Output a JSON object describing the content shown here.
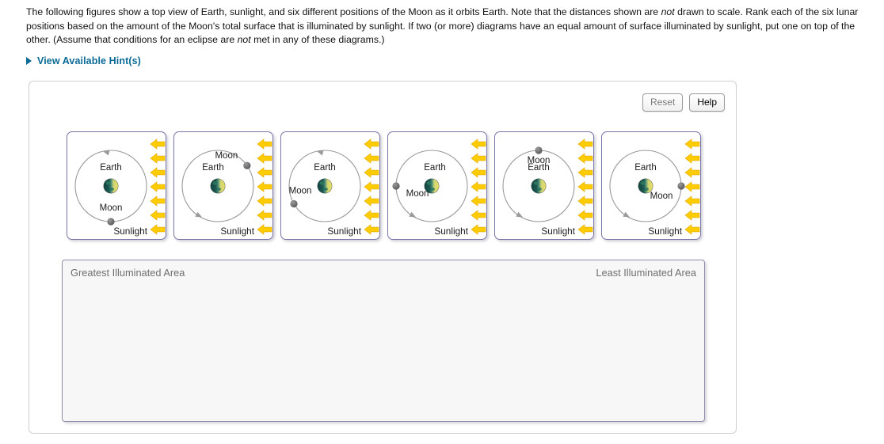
{
  "prompt": {
    "part1": "The following figures show a top view of Earth, sunlight, and six different positions of the Moon as it orbits Earth. Note that the distances shown are ",
    "em1": "not",
    "part2": " drawn to scale. Rank each of the six lunar positions based on the amount of the Moon's total surface that is illuminated by sunlight. If two (or more) diagrams have an equal amount of surface illuminated by sunlight, put one on top of the other. (Assume that conditions for an eclipse are ",
    "em2": "not",
    "part3": " met in any of these diagrams.)"
  },
  "hint": {
    "label": "View Available Hint(s)"
  },
  "toolbar": {
    "reset_label": "Reset",
    "help_label": "Help"
  },
  "ranking": {
    "greatest_label": "Greatest Illuminated Area",
    "least_label": "Least Illuminated Area",
    "items": []
  },
  "labels": {
    "earth": "Earth",
    "moon": "Moon",
    "sunlight": "Sunlight"
  },
  "colors": {
    "sun_arrow": "#FFCC00",
    "sun_arrow_edge": "#E0A800",
    "moon": "#6b6b6b",
    "earth_dark": "#1d5a52",
    "earth_lit": "#e8e06a",
    "tile_border": "#7a76a8",
    "hint_link": "#0a6a96",
    "rank_text": "#6f6f6f"
  },
  "diagrams": [
    {
      "id": "diagram-1",
      "moon_position": "bottom",
      "moon_angle_deg": 90,
      "orbit_arrow": "top",
      "earth_label_dx": 0,
      "earth_label_dy": -20,
      "moon_label_dx": 0,
      "moon_label_dy": -14,
      "phase": "new-moon"
    },
    {
      "id": "diagram-2",
      "moon_position": "upper-right",
      "moon_angle_deg": -35,
      "orbit_arrow": "bottom-left",
      "earth_label_dx": -6,
      "earth_label_dy": -20,
      "moon_label_dx": -26,
      "moon_label_dy": -9,
      "phase": "waxing-crescent"
    },
    {
      "id": "diagram-3",
      "moon_position": "lower-left",
      "moon_angle_deg": 150,
      "orbit_arrow": "top",
      "earth_label_dx": 0,
      "earth_label_dy": -20,
      "moon_label_dx": 8,
      "moon_label_dy": -13,
      "phase": "waning-crescent"
    },
    {
      "id": "diagram-4",
      "moon_position": "left",
      "moon_angle_deg": 180,
      "orbit_arrow": "bottom-left",
      "earth_label_dx": 4,
      "earth_label_dy": -20,
      "moon_label_dx": 27,
      "moon_label_dy": 13,
      "phase": "full-moon"
    },
    {
      "id": "diagram-5",
      "moon_position": "top",
      "moon_angle_deg": -90,
      "orbit_arrow": "bottom-left",
      "earth_label_dx": 0,
      "earth_label_dy": -20,
      "moon_label_dx": 0,
      "moon_label_dy": 16,
      "phase": "quarter"
    },
    {
      "id": "diagram-6",
      "moon_position": "right",
      "moon_angle_deg": 0,
      "orbit_arrow": "bottom-left",
      "earth_label_dx": 0,
      "earth_label_dy": -20,
      "moon_label_dx": -25,
      "moon_label_dy": 16,
      "phase": "new-moon"
    }
  ],
  "sun_arrow_count": 7
}
